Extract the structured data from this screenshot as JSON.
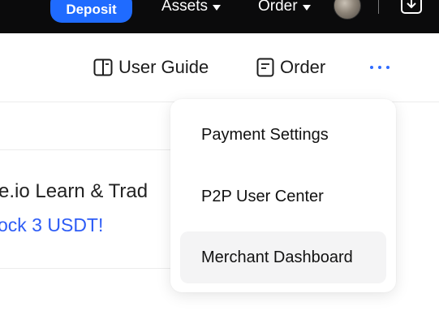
{
  "topnav": {
    "deposit_label": "Deposit",
    "assets_label": "Assets",
    "order_label": "Order",
    "accent_color": "#1f6bff"
  },
  "subheader": {
    "user_guide_label": "User Guide",
    "order_label": "Order",
    "user_guide_icon": "book-icon",
    "order_icon": "document-icon",
    "more_icon": "more-horizontal-icon"
  },
  "promo": {
    "title": "e.io Learn & Trad",
    "link": "ock 3 USDT!"
  },
  "dropdown": {
    "items": [
      {
        "label": "Payment Settings"
      },
      {
        "label": "P2P User Center"
      },
      {
        "label": "Merchant Dashboard"
      }
    ],
    "highlighted_index": 2
  }
}
